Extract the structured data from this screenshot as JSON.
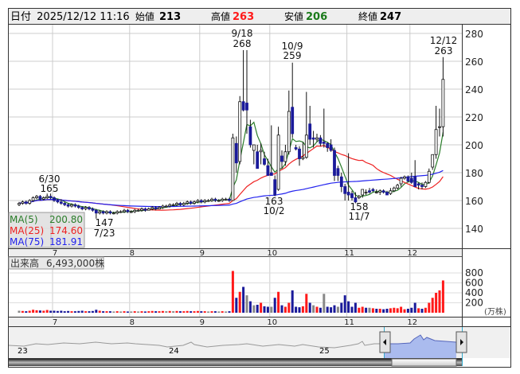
{
  "header": {
    "date_label": "日付",
    "datetime": "2025/12/12 11:16",
    "open_label": "始値",
    "open": "213",
    "high_label": "高値",
    "high": "263",
    "low_label": "安値",
    "low": "206",
    "close_label": "終値",
    "close": "247"
  },
  "ma_legend": [
    {
      "label": "MA(5)",
      "value": "200.80",
      "color": "#2a7d2a"
    },
    {
      "label": "MA(25)",
      "value": "174.60",
      "color": "#ee2222"
    },
    {
      "label": "MA(75)",
      "value": "181.91",
      "color": "#2222ee"
    }
  ],
  "volume_label": "出来高",
  "volume_value": "6,493,000株",
  "volume_unit": "(万株)",
  "annotations": [
    {
      "date": "6/30",
      "price": "165"
    },
    {
      "date": "7/23",
      "price": "147"
    },
    {
      "date": "9/18",
      "price": "268"
    },
    {
      "date": "10/2",
      "price": "163"
    },
    {
      "date": "10/9",
      "price": "259"
    },
    {
      "date": "11/7",
      "price": "158"
    },
    {
      "date": "12/12",
      "price": "263"
    }
  ],
  "navigator_years": [
    "23",
    "24",
    "25"
  ],
  "chart_data": {
    "type": "candlestick",
    "price_axis": {
      "ticks": [
        "140",
        "160",
        "180",
        "200",
        "220",
        "240",
        "260",
        "280"
      ],
      "ylim": [
        124,
        290
      ]
    },
    "volume_axis": {
      "ticks": [
        "200",
        "400",
        "600",
        "800"
      ],
      "unit": "万株"
    },
    "months": [
      "7",
      "8",
      "9",
      "10",
      "11",
      "12"
    ],
    "month_start_index": [
      10,
      32,
      52,
      72,
      94,
      112
    ],
    "ohlcv": [
      [
        157,
        159,
        156,
        158,
        40
      ],
      [
        158,
        160,
        157,
        159,
        35
      ],
      [
        159,
        160,
        157,
        158,
        30
      ],
      [
        158,
        161,
        157,
        160,
        40
      ],
      [
        160,
        163,
        159,
        162,
        60
      ],
      [
        162,
        164,
        161,
        163,
        50
      ],
      [
        163,
        164,
        160,
        161,
        45
      ],
      [
        161,
        163,
        160,
        162,
        40
      ],
      [
        162,
        165,
        161,
        163,
        55
      ],
      [
        163,
        165,
        161,
        162,
        40
      ],
      [
        162,
        163,
        159,
        160,
        40
      ],
      [
        160,
        161,
        158,
        159,
        35
      ],
      [
        159,
        161,
        157,
        158,
        40
      ],
      [
        158,
        159,
        156,
        157,
        30
      ],
      [
        157,
        158,
        155,
        156,
        35
      ],
      [
        156,
        158,
        155,
        157,
        30
      ],
      [
        157,
        158,
        155,
        156,
        30
      ],
      [
        156,
        157,
        154,
        155,
        35
      ],
      [
        155,
        156,
        153,
        154,
        40
      ],
      [
        154,
        156,
        153,
        155,
        30
      ],
      [
        155,
        156,
        153,
        154,
        30
      ],
      [
        154,
        155,
        152,
        153,
        35
      ],
      [
        153,
        154,
        147,
        151,
        60
      ],
      [
        151,
        153,
        150,
        152,
        40
      ],
      [
        152,
        153,
        150,
        151,
        30
      ],
      [
        151,
        153,
        150,
        152,
        30
      ],
      [
        152,
        153,
        150,
        151,
        30
      ],
      [
        151,
        152,
        150,
        151,
        25
      ],
      [
        151,
        153,
        150,
        152,
        30
      ],
      [
        152,
        153,
        151,
        152,
        25
      ],
      [
        152,
        154,
        151,
        153,
        30
      ],
      [
        153,
        154,
        151,
        152,
        25
      ],
      [
        152,
        153,
        151,
        152,
        25
      ],
      [
        152,
        154,
        151,
        153,
        30
      ],
      [
        153,
        154,
        152,
        153,
        25
      ],
      [
        153,
        155,
        152,
        154,
        30
      ],
      [
        154,
        155,
        152,
        153,
        25
      ],
      [
        153,
        155,
        153,
        154,
        30
      ],
      [
        154,
        156,
        153,
        155,
        35
      ],
      [
        155,
        156,
        153,
        154,
        30
      ],
      [
        154,
        156,
        154,
        155,
        30
      ],
      [
        155,
        157,
        154,
        156,
        35
      ],
      [
        156,
        157,
        155,
        156,
        30
      ],
      [
        156,
        158,
        155,
        157,
        35
      ],
      [
        157,
        158,
        156,
        157,
        30
      ],
      [
        157,
        159,
        156,
        158,
        35
      ],
      [
        158,
        159,
        156,
        157,
        30
      ],
      [
        157,
        159,
        156,
        158,
        30
      ],
      [
        158,
        160,
        157,
        159,
        35
      ],
      [
        159,
        160,
        157,
        158,
        30
      ],
      [
        158,
        160,
        157,
        159,
        30
      ],
      [
        159,
        161,
        158,
        160,
        35
      ],
      [
        160,
        161,
        158,
        159,
        30
      ],
      [
        159,
        161,
        158,
        160,
        30
      ],
      [
        160,
        161,
        159,
        160,
        25
      ],
      [
        160,
        162,
        159,
        161,
        30
      ],
      [
        161,
        162,
        159,
        160,
        30
      ],
      [
        160,
        161,
        159,
        160,
        25
      ],
      [
        160,
        162,
        159,
        161,
        30
      ],
      [
        161,
        162,
        160,
        161,
        25
      ],
      [
        161,
        162,
        159,
        160,
        30
      ],
      [
        160,
        208,
        160,
        205,
        840
      ],
      [
        201,
        206,
        180,
        187,
        300
      ],
      [
        188,
        235,
        186,
        231,
        420
      ],
      [
        231,
        268,
        224,
        225,
        520
      ],
      [
        230,
        268,
        208,
        225,
        350
      ],
      [
        213,
        218,
        198,
        200,
        230
      ],
      [
        196,
        200,
        186,
        200,
        150
      ],
      [
        195,
        200,
        183,
        183,
        160
      ],
      [
        195,
        201,
        186,
        196,
        200
      ],
      [
        190,
        195,
        185,
        186,
        130
      ],
      [
        185,
        190,
        178,
        178,
        120
      ],
      [
        180,
        214,
        178,
        178,
        120
      ],
      [
        175,
        178,
        163,
        164,
        300
      ],
      [
        168,
        213,
        167,
        207,
        420
      ],
      [
        192,
        196,
        183,
        188,
        150
      ],
      [
        188,
        200,
        185,
        195,
        120
      ],
      [
        195,
        239,
        193,
        224,
        200
      ],
      [
        227,
        259,
        205,
        208,
        450
      ],
      [
        198,
        200,
        196,
        197,
        120
      ],
      [
        197,
        199,
        185,
        190,
        110
      ],
      [
        190,
        202,
        189,
        191,
        130
      ],
      [
        191,
        238,
        190,
        207,
        380
      ],
      [
        215,
        228,
        200,
        204,
        200
      ],
      [
        205,
        210,
        198,
        204,
        150
      ],
      [
        204,
        208,
        202,
        205,
        120
      ],
      [
        205,
        207,
        199,
        201,
        100
      ],
      [
        202,
        226,
        198,
        201,
        380
      ],
      [
        201,
        202,
        195,
        198,
        120
      ],
      [
        200,
        204,
        195,
        196,
        110
      ],
      [
        196,
        198,
        174,
        178,
        150
      ],
      [
        183,
        185,
        174,
        178,
        120
      ],
      [
        177,
        180,
        166,
        170,
        200
      ],
      [
        170,
        172,
        160,
        165,
        350
      ],
      [
        166,
        194,
        160,
        164,
        230
      ],
      [
        165,
        167,
        160,
        162,
        120
      ],
      [
        162,
        166,
        158,
        159,
        200
      ],
      [
        162,
        164,
        161,
        163,
        100
      ],
      [
        164,
        168,
        162,
        168,
        120
      ],
      [
        166,
        168,
        164,
        166,
        100
      ],
      [
        167,
        169,
        165,
        166,
        100
      ],
      [
        168,
        169,
        166,
        167,
        90
      ],
      [
        166,
        168,
        165,
        166,
        80
      ],
      [
        166,
        168,
        164,
        167,
        80
      ],
      [
        167,
        168,
        165,
        166,
        70
      ],
      [
        166,
        167,
        164,
        164,
        80
      ],
      [
        165,
        169,
        164,
        167,
        90
      ],
      [
        167,
        170,
        166,
        169,
        100
      ],
      [
        169,
        172,
        168,
        171,
        90
      ],
      [
        172,
        177,
        170,
        176,
        120
      ],
      [
        176,
        178,
        175,
        177,
        70
      ],
      [
        177,
        178,
        173,
        174,
        80
      ],
      [
        176,
        180,
        172,
        173,
        100
      ],
      [
        177,
        189,
        170,
        170,
        200
      ],
      [
        172,
        173,
        168,
        171,
        90
      ],
      [
        171,
        173,
        168,
        170,
        80
      ],
      [
        170,
        174,
        169,
        173,
        100
      ],
      [
        173,
        183,
        172,
        181,
        200
      ],
      [
        184,
        193,
        182,
        193,
        300
      ],
      [
        193,
        228,
        190,
        211,
        400
      ],
      [
        213,
        226,
        206,
        213,
        450
      ],
      [
        213,
        263,
        206,
        247,
        649
      ]
    ]
  }
}
